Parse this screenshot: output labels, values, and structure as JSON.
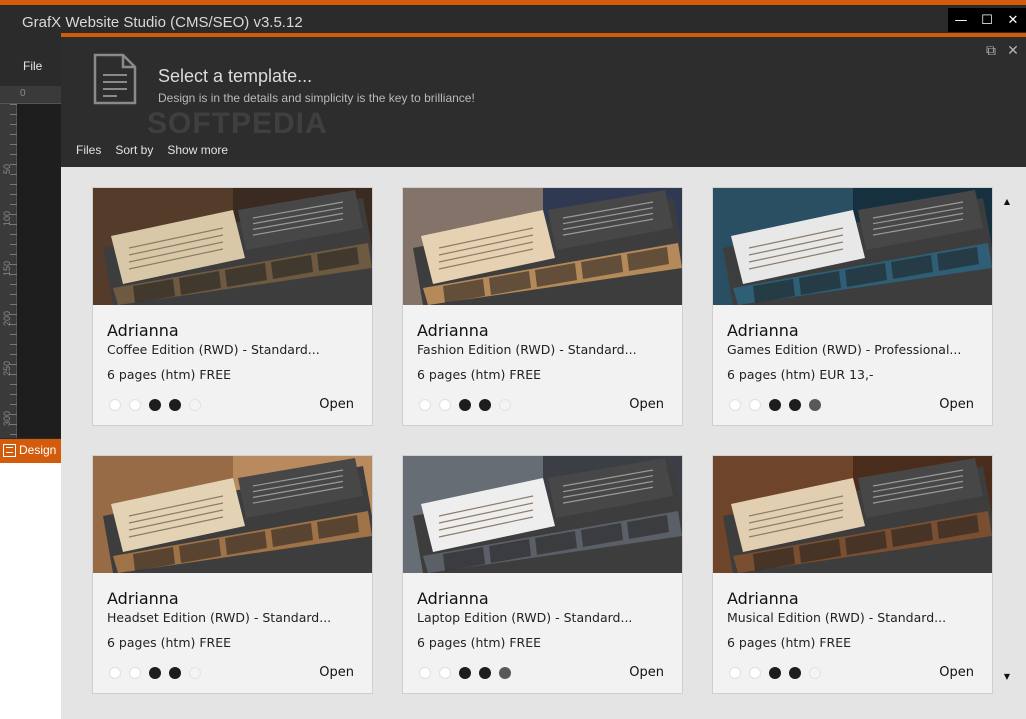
{
  "app": {
    "title": "GrafX Website Studio (CMS/SEO) v3.5.12",
    "menu_file": "File",
    "ruler_top": "0",
    "ruler_left": [
      "50",
      "100",
      "150",
      "200",
      "250",
      "300"
    ],
    "design_tab": "Design",
    "window_controls": {
      "minimize": "—",
      "maximize": "☐",
      "close": "✕"
    }
  },
  "dialog": {
    "title": "Select a template...",
    "subtitle": "Design is in the details and simplicity is the key to brilliance!",
    "menu": {
      "files": "Files",
      "sort_by": "Sort by",
      "show_more": "Show more"
    },
    "controls": {
      "restore": "⧉",
      "close": "✕"
    }
  },
  "watermark": "SOFTPEDIA",
  "templates": [
    {
      "name": "Adrianna",
      "edition": "Coffee Edition (RWD) - Standard...",
      "price": "6 pages (htm) FREE",
      "open": "Open",
      "dots": [
        "empty",
        "empty",
        "full",
        "full",
        "faint"
      ],
      "theme": "coffee"
    },
    {
      "name": "Adrianna",
      "edition": "Fashion Edition (RWD) - Standard...",
      "price": "6 pages (htm) FREE",
      "open": "Open",
      "dots": [
        "empty",
        "empty",
        "full",
        "full",
        "faint"
      ],
      "theme": "fashion"
    },
    {
      "name": "Adrianna",
      "edition": "Games Edition (RWD) - Professional...",
      "price": "6 pages (htm) EUR 13,-",
      "open": "Open",
      "dots": [
        "empty",
        "empty",
        "full",
        "full",
        "mid"
      ],
      "theme": "games"
    },
    {
      "name": "Adrianna",
      "edition": "Headset Edition (RWD) - Standard...",
      "price": "6 pages (htm) FREE",
      "open": "Open",
      "dots": [
        "empty",
        "empty",
        "full",
        "full",
        "faint"
      ],
      "theme": "headset"
    },
    {
      "name": "Adrianna",
      "edition": "Laptop Edition (RWD) - Standard...",
      "price": "6 pages (htm) FREE",
      "open": "Open",
      "dots": [
        "empty",
        "empty",
        "full",
        "full",
        "mid"
      ],
      "theme": "laptop"
    },
    {
      "name": "Adrianna",
      "edition": "Musical Edition (RWD) - Standard...",
      "price": "6 pages (htm) FREE",
      "open": "Open",
      "dots": [
        "empty",
        "empty",
        "full",
        "full",
        "faint"
      ],
      "theme": "musical"
    }
  ],
  "themes": {
    "coffee": {
      "bg": "#3a2a1f",
      "accent": "#6b4a33",
      "panel": "#d8c8a8",
      "strip": "#6e5a40"
    },
    "fashion": {
      "bg": "#2f3a52",
      "accent": "#c9a27a",
      "panel": "#e6d2b3",
      "strip": "#b58a5a"
    },
    "games": {
      "bg": "#17303f",
      "accent": "#3b6a82",
      "panel": "#e8e8e8",
      "strip": "#2e5f77"
    },
    "headset": {
      "bg": "#b98a5e",
      "accent": "#7a5233",
      "panel": "#e4d2b4",
      "strip": "#a07248"
    },
    "laptop": {
      "bg": "#3b3f45",
      "accent": "#8d939b",
      "panel": "#eeeeee",
      "strip": "#5b6068"
    },
    "musical": {
      "bg": "#4a2c1c",
      "accent": "#8c5a38",
      "panel": "#e2cfb2",
      "strip": "#7a4e30"
    }
  }
}
